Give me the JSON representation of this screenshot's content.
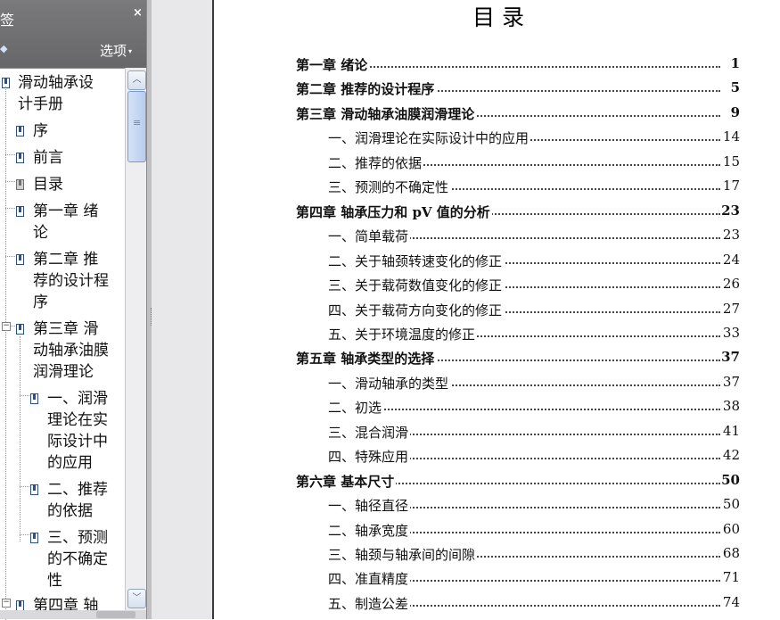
{
  "panel": {
    "title": "签",
    "close_label": "×",
    "expand_label": "◆",
    "options_label": "选项",
    "options_arrow": "▾"
  },
  "bookmarks": {
    "root": {
      "lines": [
        "滑动轴承设",
        "计手册"
      ]
    },
    "items": [
      {
        "lines": [
          "序"
        ]
      },
      {
        "lines": [
          "前言"
        ]
      },
      {
        "lines": [
          "目录"
        ]
      },
      {
        "lines": [
          "第一章  绪",
          "论"
        ]
      },
      {
        "lines": [
          "第二章  推",
          "荐的设计程",
          "序"
        ]
      },
      {
        "lines": [
          "第三章  滑",
          "动轴承油膜",
          "润滑理论"
        ]
      },
      {
        "lines": [
          "一、润滑",
          "理论在实",
          "际设计中",
          "的应用"
        ]
      },
      {
        "lines": [
          "二、推荐",
          "的依据"
        ]
      },
      {
        "lines": [
          "三、预测",
          "的不确定",
          "性"
        ]
      },
      {
        "lines": [
          "第四章  轴"
        ]
      }
    ],
    "toggle_minus": "−",
    "scroll_up": "︿",
    "scroll_down": "﹀"
  },
  "document": {
    "title": "目          录",
    "entries": [
      {
        "label": "第一章   绪论",
        "page": "1",
        "level": "chapter"
      },
      {
        "label": "第二章   推荐的设计程序",
        "page": "5",
        "level": "chapter"
      },
      {
        "label": "第三章   滑动轴承油膜润滑理论",
        "page": "9",
        "level": "chapter"
      },
      {
        "label": "一、润滑理论在实际设计中的应用",
        "page": "14",
        "level": "section"
      },
      {
        "label": "二、推荐的依据",
        "page": "15",
        "level": "section"
      },
      {
        "label": "三、预测的不确定性",
        "page": "17",
        "level": "section"
      },
      {
        "label": "第四章   轴承压力和 pV 值的分析",
        "page": "23",
        "level": "chapter"
      },
      {
        "label": "一、简单载荷",
        "page": "23",
        "level": "section"
      },
      {
        "label": "二、关于轴颈转速变化的修正",
        "page": "24",
        "level": "section"
      },
      {
        "label": "三、关于载荷数值变化的修正",
        "page": "26",
        "level": "section"
      },
      {
        "label": "四、关于载荷方向变化的修正",
        "page": "27",
        "level": "section"
      },
      {
        "label": "五、关于环境温度的修正",
        "page": "33",
        "level": "section"
      },
      {
        "label": "第五章   轴承类型的选择",
        "page": "37",
        "level": "chapter"
      },
      {
        "label": "一、滑动轴承的类型",
        "page": "37",
        "level": "section"
      },
      {
        "label": "二、初选",
        "page": "38",
        "level": "section"
      },
      {
        "label": "三、混合润滑",
        "page": "41",
        "level": "section"
      },
      {
        "label": "四、特殊应用",
        "page": "42",
        "level": "section"
      },
      {
        "label": "第六章   基本尺寸",
        "page": "50",
        "level": "chapter"
      },
      {
        "label": "一、轴径直径",
        "page": "50",
        "level": "section"
      },
      {
        "label": "二、轴承宽度",
        "page": "60",
        "level": "section"
      },
      {
        "label": "三、轴颈与轴承间的间隙",
        "page": "68",
        "level": "section"
      },
      {
        "label": "四、准直精度",
        "page": "71",
        "level": "section"
      },
      {
        "label": "五、制造公差",
        "page": "74",
        "level": "section"
      }
    ]
  }
}
